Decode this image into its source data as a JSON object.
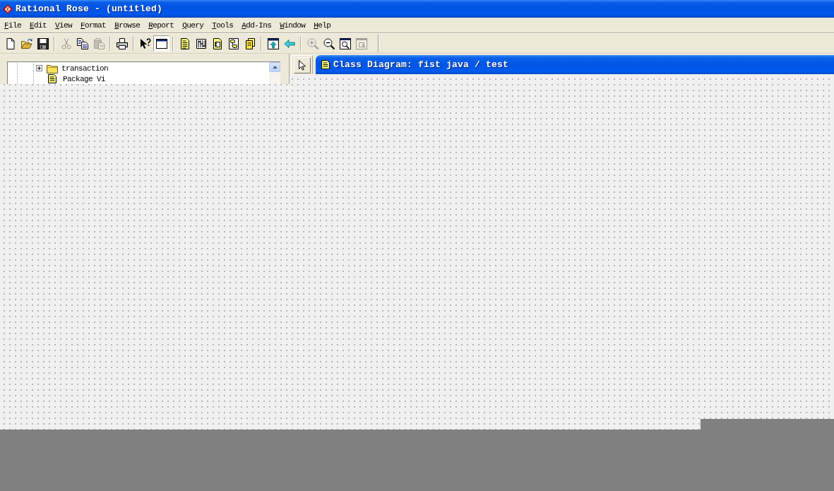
{
  "window": {
    "title": "Rational Rose - (untitled)"
  },
  "menu": [
    {
      "label": "File"
    },
    {
      "label": "Edit"
    },
    {
      "label": "View"
    },
    {
      "label": "Format"
    },
    {
      "label": "Browse"
    },
    {
      "label": "Report"
    },
    {
      "label": "Query"
    },
    {
      "label": "Tools"
    },
    {
      "label": "Add-Ins"
    },
    {
      "label": "Window"
    },
    {
      "label": "Help"
    }
  ],
  "toolbar": {
    "groups": [
      [
        {
          "kind": "new",
          "disabled": false,
          "pressed": false
        },
        {
          "kind": "open",
          "disabled": false,
          "pressed": false
        },
        {
          "kind": "save",
          "disabled": false,
          "pressed": false
        }
      ],
      [
        {
          "kind": "cut",
          "disabled": true,
          "pressed": false
        },
        {
          "kind": "copy",
          "disabled": false,
          "pressed": false
        },
        {
          "kind": "paste",
          "disabled": true,
          "pressed": false
        }
      ],
      [
        {
          "kind": "print",
          "disabled": false,
          "pressed": false
        }
      ],
      [
        {
          "kind": "context_help",
          "disabled": false,
          "pressed": false
        },
        {
          "kind": "browser",
          "disabled": false,
          "pressed": true
        }
      ],
      [
        {
          "kind": "class_diagram",
          "disabled": false,
          "pressed": false
        },
        {
          "kind": "interaction_diagram",
          "disabled": false,
          "pressed": false
        },
        {
          "kind": "component_diagram",
          "disabled": false,
          "pressed": false
        },
        {
          "kind": "statechart_diagram",
          "disabled": false,
          "pressed": false
        },
        {
          "kind": "deployment_diagram",
          "disabled": false,
          "pressed": false
        }
      ],
      [
        {
          "kind": "browse_parent",
          "disabled": false,
          "pressed": false
        },
        {
          "kind": "previous_diagram",
          "disabled": false,
          "pressed": false
        }
      ],
      [
        {
          "kind": "zoom_in",
          "disabled": true,
          "pressed": false
        },
        {
          "kind": "zoom_out",
          "disabled": false,
          "pressed": false
        },
        {
          "kind": "fit_in_window",
          "disabled": false,
          "pressed": false
        },
        {
          "kind": "undo_fit",
          "disabled": true,
          "pressed": false
        }
      ]
    ]
  },
  "browser": {
    "items": [
      {
        "kind": "package",
        "label": "transaction",
        "expanded": false
      },
      {
        "kind": "diagram",
        "label": "Package Vi"
      }
    ]
  },
  "diagram_toolbox": {
    "tools": [
      {
        "kind": "pointer"
      }
    ]
  },
  "diagram_window": {
    "title": "Class Diagram: fist java / test"
  }
}
